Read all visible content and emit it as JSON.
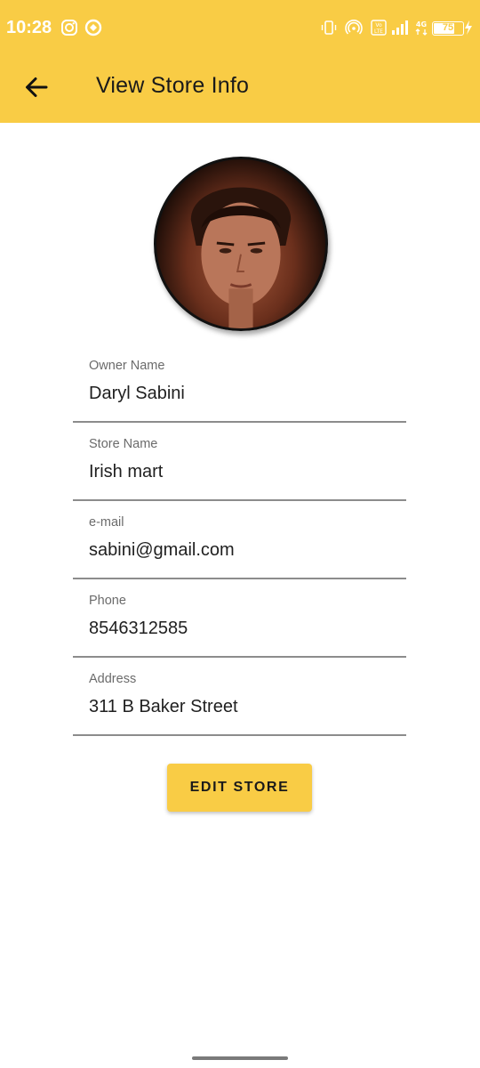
{
  "status_bar": {
    "time": "10:28",
    "battery_level": "75",
    "left_icons": [
      "instagram-icon",
      "app-notification-icon"
    ],
    "right_icons": [
      "vibrate-icon",
      "hotspot-icon",
      "volte-icon",
      "signal-icon",
      "4g-icon",
      "battery-icon",
      "charging-icon"
    ]
  },
  "header": {
    "title": "View Store Info",
    "back_icon": "arrow-back-icon"
  },
  "profile": {
    "avatar_alt": "store-owner-avatar"
  },
  "fields": [
    {
      "label": "Owner Name",
      "value": "Daryl Sabini"
    },
    {
      "label": "Store Name",
      "value": "Irish mart"
    },
    {
      "label": "e-mail",
      "value": "sabini@gmail.com"
    },
    {
      "label": "Phone",
      "value": "8546312585"
    },
    {
      "label": "Address",
      "value": "311 B Baker Street"
    }
  ],
  "actions": {
    "edit_label": "EDIT STORE"
  },
  "colors": {
    "accent": "#f9cc45",
    "divider": "#8c8c8c",
    "label": "#6b6b6b"
  }
}
